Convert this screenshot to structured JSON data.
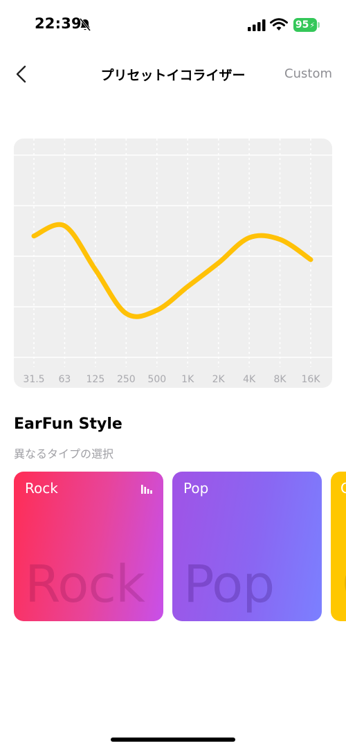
{
  "status_bar": {
    "time": "22:39",
    "battery": "95",
    "icons": [
      "bell-slash-icon",
      "signal-icon",
      "wifi-icon",
      "battery-charging-icon"
    ]
  },
  "nav": {
    "title": "プリセットイコライザー",
    "right_action": "Custom",
    "back_icon": "chevron-left-icon"
  },
  "equalizer": {
    "bands": [
      "31.5",
      "63",
      "125",
      "250",
      "500",
      "1K",
      "2K",
      "4K",
      "8K",
      "16K"
    ],
    "levels": [
      1.2,
      1.8,
      -0.8,
      -3.4,
      -3.2,
      -1.8,
      -0.4,
      1.1,
      1.0,
      -0.2
    ],
    "level_range": [
      -6,
      6
    ],
    "curve_color": "#ffc107"
  },
  "section": {
    "title": "EarFun Style",
    "subtitle": "異なるタイプの選択"
  },
  "styles": [
    {
      "label": "Rock",
      "watermark": "Rock",
      "active": true
    },
    {
      "label": "Pop",
      "watermark": "Pop",
      "active": false
    },
    {
      "label": "C",
      "watermark": "C",
      "active": false
    }
  ]
}
